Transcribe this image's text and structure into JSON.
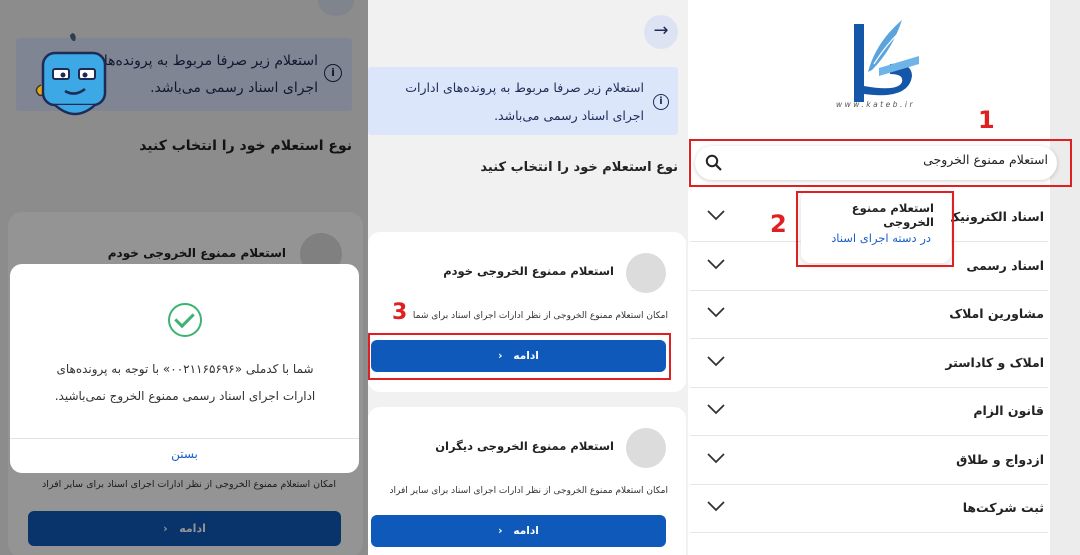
{
  "panel_left": {
    "info_text": "استعلام زیر صرفا مربوط به پرونده‌های ادارات اجرای اسناد رسمی می‌باشد.",
    "info_icon": "info-icon",
    "section_title": "نوع استعلام خود را انتخاب کنید",
    "option_title": "استعلام ممنوع الخروجی خودم",
    "option_desc": "امکان استعلام ممنوع الخروجی از نظر ادارات اجرای اسناد برای سایر افراد",
    "continue_label": "ادامه",
    "modal": {
      "icon": "check-circle-icon",
      "message": "شما با کدملی «۰۰۲۱۱۶۵۶۹۶» با توجه به پرونده‌های ادارات اجرای اسناد رسمی ممنوع الخروج نمی‌باشید.",
      "close_label": "بستن"
    }
  },
  "panel_middle": {
    "back_icon": "arrow-right-icon",
    "info_text": "استعلام زیر صرفا مربوط به پرونده‌های ادارات اجرای اسناد رسمی می‌باشد.",
    "section_title": "نوع استعلام خود را انتخاب کنید",
    "options": [
      {
        "title": "استعلام ممنوع الخروجی خودم",
        "desc": "امکان استعلام ممنوع الخروجی از نظر ادارات اجرای اسناد برای شما",
        "continue_label": "ادامه"
      },
      {
        "title": "استعلام ممنوع الخروجی دیگران",
        "desc": "امکان استعلام ممنوع الخروجی از نظر ادارات اجرای اسناد برای سایر افراد",
        "continue_label": "ادامه"
      }
    ],
    "step_number": "3"
  },
  "panel_right": {
    "logo_url": "www.kateb.ir",
    "step1": "1",
    "step2": "2",
    "search": {
      "value": "استعلام ممنوع الخروجی",
      "icon": "search-icon"
    },
    "dropdown": {
      "title": "استعلام ممنوع الخروجی",
      "subtitle": "در دسته اجرای اسناد"
    },
    "menu": [
      "اسناد الکترونیک",
      "اسناد رسمی",
      "مشاورین املاک",
      "املاک و کاداستر",
      "قانون الزام",
      "ازدواج و طلاق",
      "ثبت شرکت‌ها"
    ]
  },
  "colors": {
    "primary": "#0e59b9",
    "info_bg": "#dbe6fb",
    "annotation_red": "#e02020",
    "success": "#3cb371",
    "link": "#1a5fc8"
  }
}
